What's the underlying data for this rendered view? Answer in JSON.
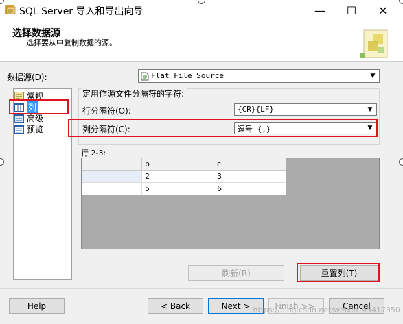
{
  "window": {
    "title": "SQL Server 导入和导出向导",
    "minimize_glyph": "—",
    "maximize_glyph": "☐",
    "close_glyph": "✕"
  },
  "header": {
    "title": "选择数据源",
    "subtitle": "选择要从中复制数据的源。"
  },
  "data_source": {
    "label": "数据源(D):",
    "value": "Flat File Source"
  },
  "nav": {
    "items": [
      {
        "label": "常规",
        "icon": "general-icon"
      },
      {
        "label": "列",
        "icon": "columns-icon",
        "selected": true
      },
      {
        "label": "高级",
        "icon": "advanced-icon"
      },
      {
        "label": "预览",
        "icon": "preview-icon"
      }
    ]
  },
  "delimiters": {
    "group_title": "定用作源文件分隔符的字符:",
    "row_label": "行分隔符(O):",
    "row_value": "{CR}{LF}",
    "col_label": "列分隔符(C):",
    "col_value": "逗号 {,}"
  },
  "preview": {
    "label": "行 2-3:",
    "columns": [
      "",
      "b",
      "c"
    ],
    "rows": [
      [
        "",
        "2",
        "3"
      ],
      [
        "",
        "5",
        "6"
      ]
    ]
  },
  "actions": {
    "refresh_label": "刷新(R)",
    "reset_label": "重置列(T)"
  },
  "footer": {
    "help_label": "Help",
    "back_label": "< Back",
    "next_label": "Next >",
    "finish_label": "Finish >>|",
    "cancel_label": "Cancel"
  },
  "watermark": "https://blog.csdn.net/weixin_43417350",
  "colors": {
    "highlight_red": "#e0141e",
    "selection_blue": "#3399ff",
    "dialog_bg": "#f0f0f0"
  }
}
